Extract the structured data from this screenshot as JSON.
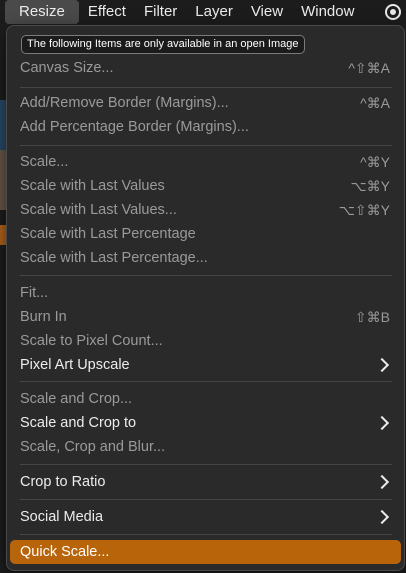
{
  "menubar": {
    "items": [
      "Resize",
      "Effect",
      "Filter",
      "Layer",
      "View",
      "Window"
    ],
    "status_icon": "record-circle-icon"
  },
  "menu": {
    "notice": "The following Items are only available in an open Image",
    "items": [
      {
        "label": "Canvas Size...",
        "shortcut": "^⇧⌘A",
        "enabled": false
      },
      {
        "label": "Add/Remove Border (Margins)...",
        "shortcut": "^⌘A",
        "enabled": false
      },
      {
        "label": "Add Percentage Border (Margins)...",
        "shortcut": "",
        "enabled": false
      },
      {
        "label": "Scale...",
        "shortcut": "^⌘Y",
        "enabled": false
      },
      {
        "label": "Scale with Last Values",
        "shortcut": "⌥⌘Y",
        "enabled": false
      },
      {
        "label": "Scale with Last Values...",
        "shortcut": "⌥⇧⌘Y",
        "enabled": false
      },
      {
        "label": "Scale with Last Percentage",
        "shortcut": "",
        "enabled": false
      },
      {
        "label": "Scale with Last Percentage...",
        "shortcut": "",
        "enabled": false
      },
      {
        "label": "Fit...",
        "shortcut": "",
        "enabled": false
      },
      {
        "label": "Burn In",
        "shortcut": "⇧⌘B",
        "enabled": false
      },
      {
        "label": "Scale to Pixel Count...",
        "shortcut": "",
        "enabled": false
      },
      {
        "label": "Pixel Art Upscale",
        "shortcut": "",
        "enabled": true,
        "submenu": true
      },
      {
        "label": "Scale and Crop...",
        "shortcut": "",
        "enabled": false
      },
      {
        "label": "Scale and Crop to",
        "shortcut": "",
        "enabled": true,
        "submenu": true
      },
      {
        "label": "Scale, Crop and Blur...",
        "shortcut": "",
        "enabled": false
      },
      {
        "label": "Crop to Ratio",
        "shortcut": "",
        "enabled": true,
        "submenu": true
      },
      {
        "label": "Social Media",
        "shortcut": "",
        "enabled": true,
        "submenu": true
      },
      {
        "label": "Quick Scale...",
        "shortcut": "",
        "enabled": true,
        "highlighted": true
      }
    ]
  },
  "colors": {
    "highlight": "#b8640b",
    "menu_bg": "#2a2a2a",
    "disabled_text": "#9a9a9a"
  }
}
